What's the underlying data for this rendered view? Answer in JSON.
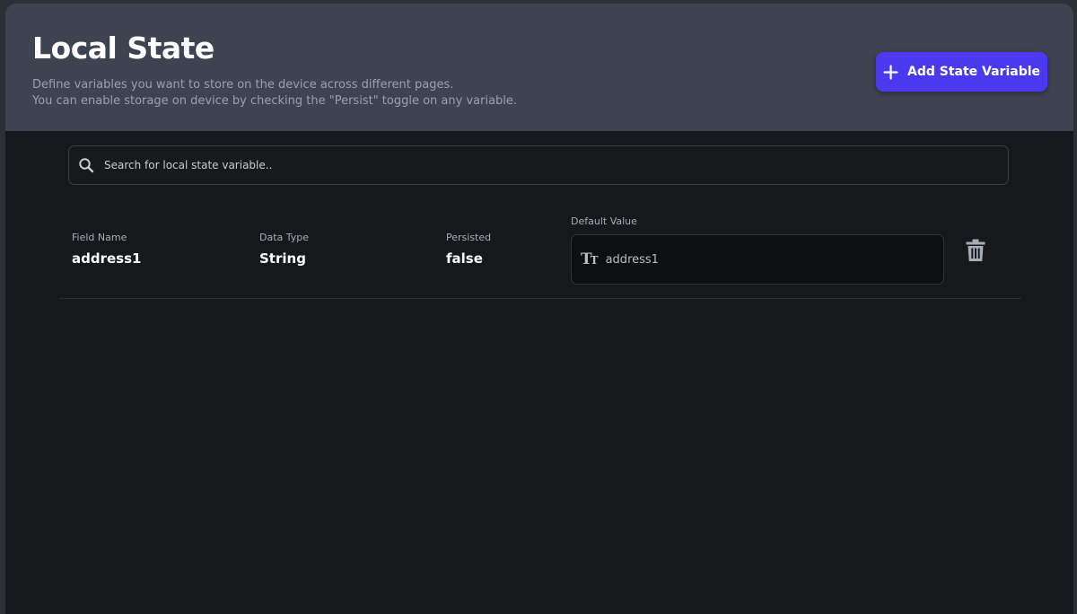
{
  "header": {
    "title": "Local State",
    "description_line1": "Define variables you want to store on the device across different pages.",
    "description_line2": "You can enable storage on device by checking the \"Persist\" toggle on any variable.",
    "add_button_label": "Add State Variable",
    "add_button_icon": "plus-icon"
  },
  "search": {
    "placeholder": "Search for local state variable..",
    "value": "",
    "icon": "search-icon"
  },
  "variables": [
    {
      "field_name_label": "Field Name",
      "field_name": "address1",
      "data_type_label": "Data Type",
      "data_type": "String",
      "persisted_label": "Persisted",
      "persisted": "false",
      "default_value_label": "Default Value",
      "default_value": "address1",
      "type_icon": "text-type-icon",
      "delete_icon": "trash-icon"
    }
  ],
  "colors": {
    "accent": "#4b39ef",
    "header_bg": "#3d4350",
    "page_bg": "#16181b"
  }
}
